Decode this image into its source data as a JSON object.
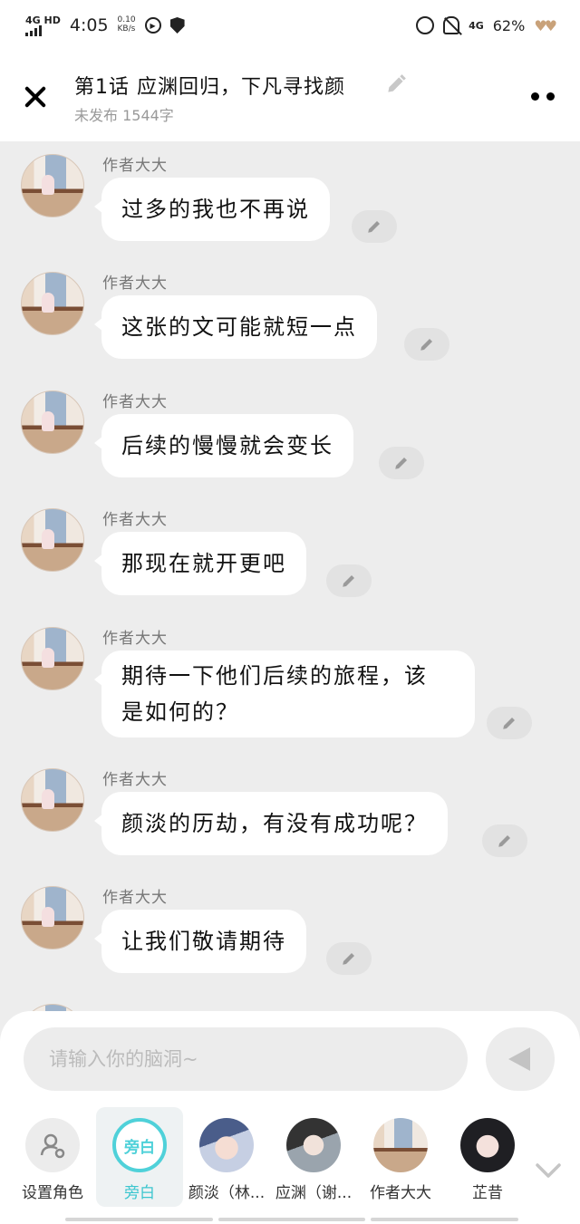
{
  "status_bar": {
    "network": "4G HD",
    "time": "4:05",
    "speed_value": "0.10",
    "speed_unit": "KB/s",
    "net_right": "4G",
    "battery": "62%"
  },
  "header": {
    "title": "第1话  应渊回归，下凡寻找颜",
    "subtitle": "未发布 1544字"
  },
  "messages": [
    {
      "author": "作者大大",
      "text": "过多的我也不再说"
    },
    {
      "author": "作者大大",
      "text": "这张的文可能就短一点"
    },
    {
      "author": "作者大大",
      "text": "后续的慢慢就会变长"
    },
    {
      "author": "作者大大",
      "text": "那现在就开更吧"
    },
    {
      "author": "作者大大",
      "text": "期待一下他们后续的旅程，该是如何的？",
      "line1": "期待一下他们后续的旅程，该",
      "line2": "是如何的？"
    },
    {
      "author": "作者大大",
      "text": "颜淡的历劫，有没有成功呢？"
    },
    {
      "author": "作者大大",
      "text": "让我们敬请期待"
    }
  ],
  "input": {
    "placeholder": "请输入你的脑洞~"
  },
  "roles": [
    {
      "label": "设置角色",
      "icon": "person-settings-icon"
    },
    {
      "label": "旁白",
      "avatar_text": "旁白",
      "selected": true
    },
    {
      "label": "颜淡（林..."
    },
    {
      "label": "应渊（谢..."
    },
    {
      "label": "作者大大"
    },
    {
      "label": "芷昔"
    }
  ],
  "colors": {
    "accent": "#4fd1d9",
    "background": "#ededed",
    "bubble": "#ffffff"
  }
}
